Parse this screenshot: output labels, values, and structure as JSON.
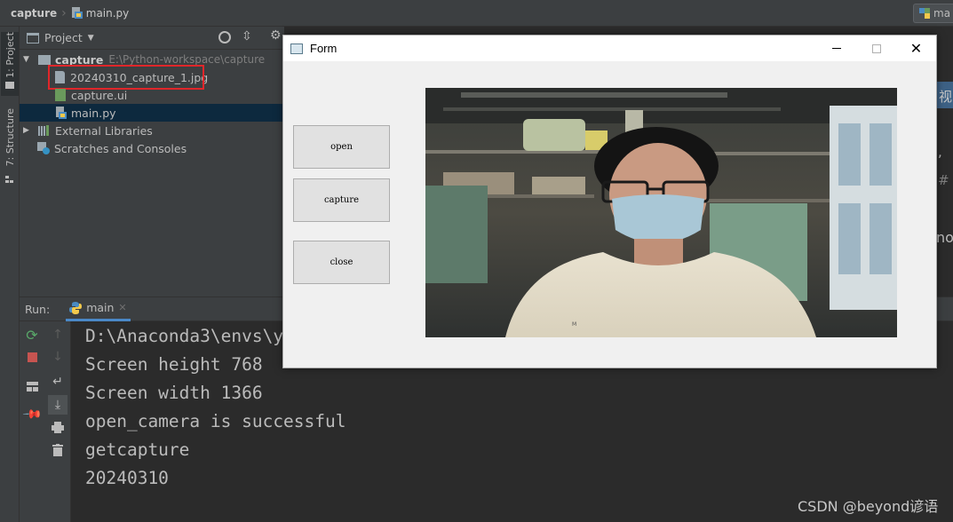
{
  "breadcrumb": {
    "project": "capture",
    "file": "main.py",
    "right_tab": "ma"
  },
  "tool_strip": {
    "project_tab": "1: Project",
    "structure_tab": "7: Structure"
  },
  "project_panel": {
    "header": "Project",
    "root": {
      "name": "capture",
      "path": "E:\\Python-workspace\\capture"
    },
    "files": [
      "20240310_capture_1.jpg",
      "capture.ui",
      "main.py"
    ],
    "external": "External Libraries",
    "scratches": "Scratches and Consoles"
  },
  "editor_edge": {
    "chars": [
      "视",
      ",",
      "#",
      "no"
    ]
  },
  "run": {
    "label": "Run:",
    "tab": "main",
    "console": [
      "D:\\Anaconda3\\envs\\y",
      "Screen height 768",
      "Screen width 1366",
      "open_camera is successful",
      "getcapture",
      "20240310"
    ]
  },
  "form": {
    "title": "Form",
    "buttons": {
      "open": "open",
      "capture": "capture",
      "close": "close"
    }
  },
  "watermark": "CSDN @beyond谚语",
  "colors": {
    "highlight_box": "#e0262a",
    "selection": "#0d293e",
    "panel": "#3c3f41",
    "console_bg": "#2b2b2b"
  }
}
